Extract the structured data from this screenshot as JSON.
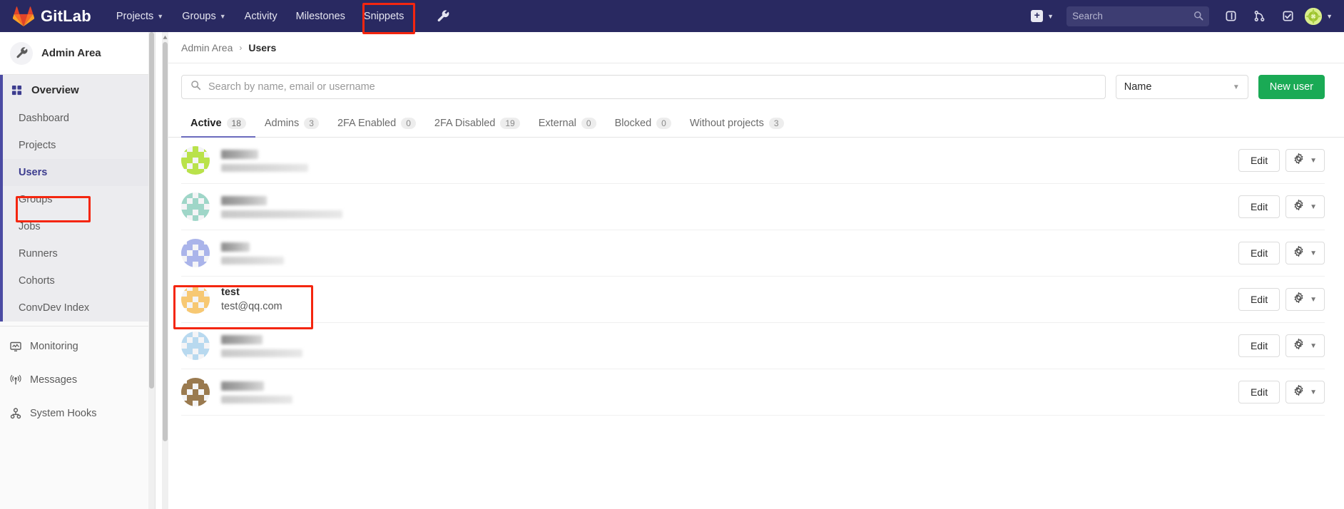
{
  "navbar": {
    "brand": "GitLab",
    "links": [
      {
        "label": "Projects",
        "has_caret": true
      },
      {
        "label": "Groups",
        "has_caret": true
      },
      {
        "label": "Activity",
        "has_caret": false
      },
      {
        "label": "Milestones",
        "has_caret": false
      },
      {
        "label": "Snippets",
        "has_caret": false
      }
    ],
    "admin_icon": "wrench-icon",
    "plus_label": "+",
    "search_placeholder": "Search",
    "icons": [
      "issues-icon",
      "merge-requests-icon",
      "todos-icon"
    ],
    "avatar": "user-avatar"
  },
  "sidebar": {
    "title": "Admin Area",
    "title_icon": "wrench-icon",
    "overview": {
      "label": "Overview",
      "icon": "grid-icon"
    },
    "sub_items": [
      {
        "label": "Dashboard",
        "selected": false
      },
      {
        "label": "Projects",
        "selected": false
      },
      {
        "label": "Users",
        "selected": true
      },
      {
        "label": "Groups",
        "selected": false
      },
      {
        "label": "Jobs",
        "selected": false
      },
      {
        "label": "Runners",
        "selected": false
      },
      {
        "label": "Cohorts",
        "selected": false
      },
      {
        "label": "ConvDev Index",
        "selected": false
      }
    ],
    "bottom_items": [
      {
        "label": "Monitoring",
        "icon": "monitor-icon"
      },
      {
        "label": "Messages",
        "icon": "broadcast-icon"
      },
      {
        "label": "System Hooks",
        "icon": "hook-icon"
      }
    ]
  },
  "breadcrumb": {
    "parent": "Admin Area",
    "separator": "›",
    "current": "Users"
  },
  "toolbar": {
    "search_placeholder": "Search by name, email or username",
    "search_value": "",
    "sort_value": "Name",
    "new_user_label": "New user"
  },
  "tabs": [
    {
      "label": "Active",
      "count": "18",
      "active": true
    },
    {
      "label": "Admins",
      "count": "3",
      "active": false
    },
    {
      "label": "2FA Enabled",
      "count": "0",
      "active": false
    },
    {
      "label": "2FA Disabled",
      "count": "19",
      "active": false
    },
    {
      "label": "External",
      "count": "0",
      "active": false
    },
    {
      "label": "Blocked",
      "count": "0",
      "active": false
    },
    {
      "label": "Without projects",
      "count": "3",
      "active": false
    }
  ],
  "users": [
    {
      "name": "",
      "email": "",
      "blurred": true,
      "name_w": 52,
      "mail_w": 122,
      "avatar": "#b9e24a",
      "edit": "Edit",
      "highlighted": false
    },
    {
      "name": "",
      "email": "",
      "blurred": true,
      "name_w": 64,
      "mail_w": 170,
      "avatar": "#9fd6c8",
      "edit": "Edit",
      "highlighted": false
    },
    {
      "name": "",
      "email": "",
      "blurred": true,
      "name_w": 40,
      "mail_w": 88,
      "avatar": "#aab4ea",
      "edit": "Edit",
      "highlighted": false
    },
    {
      "name": "test",
      "email": "test@qq.com",
      "blurred": false,
      "name_w": 0,
      "mail_w": 0,
      "avatar": "#f7c873",
      "edit": "Edit",
      "highlighted": true
    },
    {
      "name": "",
      "email": "",
      "blurred": true,
      "name_w": 58,
      "mail_w": 114,
      "avatar": "#b8d9ef",
      "edit": "Edit",
      "highlighted": false
    },
    {
      "name": "",
      "email": "",
      "blurred": true,
      "name_w": 60,
      "mail_w": 100,
      "avatar": "#9a7a4f",
      "edit": "Edit",
      "highlighted": false
    }
  ],
  "annotations": {
    "color": "#f4260f",
    "targets": [
      "navbar-admin-wrench",
      "sidebar-users-item",
      "user-row-test"
    ]
  }
}
